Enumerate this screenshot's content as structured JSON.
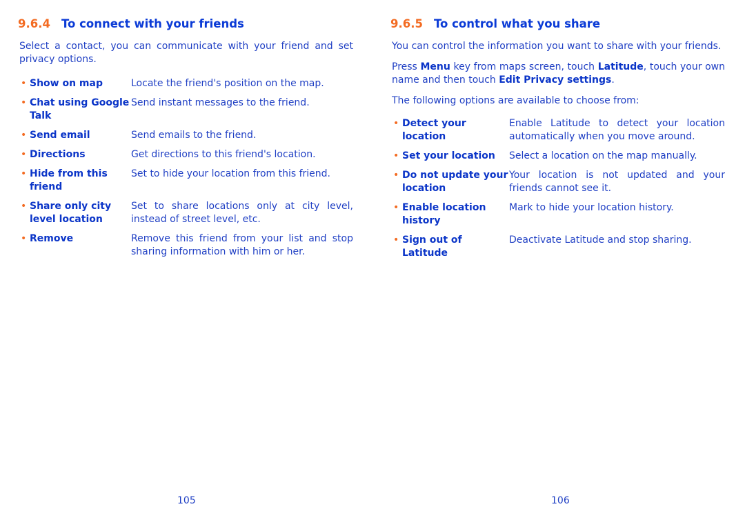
{
  "left": {
    "num": "9.6.4",
    "title": "To connect with your friends",
    "intro": "Select a contact, you can communicate with your friend and set privacy options.",
    "items": [
      {
        "term": "Show on map",
        "desc": "Locate the friend's position on the map."
      },
      {
        "term": "Chat using Google Talk",
        "desc": "Send instant messages to the friend."
      },
      {
        "term": "Send email",
        "desc": "Send emails to the friend."
      },
      {
        "term": "Directions",
        "desc": "Get directions to this friend's location."
      },
      {
        "term": "Hide from this friend",
        "desc": "Set to hide your location from this friend."
      },
      {
        "term": "Share only city level location",
        "desc": "Set to share locations only at city level, instead of street level, etc."
      },
      {
        "term": "Remove",
        "desc": "Remove this friend from your list and stop sharing information with him or her."
      }
    ],
    "page": "105"
  },
  "right": {
    "num": "9.6.5",
    "title": "To control what you share",
    "intro": "You can control the information you want to share with your friends.",
    "press": {
      "t1": "Press ",
      "b1": "Menu",
      "t2": " key from maps screen, touch ",
      "b2": "Latitude",
      "t3": ", touch your own name and then touch ",
      "b3": "Edit Privacy settings",
      "t4": "."
    },
    "options_intro": "The following options are available to choose from:",
    "items": [
      {
        "term": "Detect your location",
        "desc": "Enable Latitude to detect your location automatically when you move around."
      },
      {
        "term": "Set your location",
        "desc": "Select a location on the map manually."
      },
      {
        "term": "Do not update your location",
        "desc": "Your location is not updated and your friends cannot see it."
      },
      {
        "term": "Enable location history",
        "desc": "Mark to hide your location history."
      },
      {
        "term": "Sign out of Latitude",
        "desc": "Deactivate Latitude and stop sharing."
      }
    ],
    "page": "106"
  }
}
